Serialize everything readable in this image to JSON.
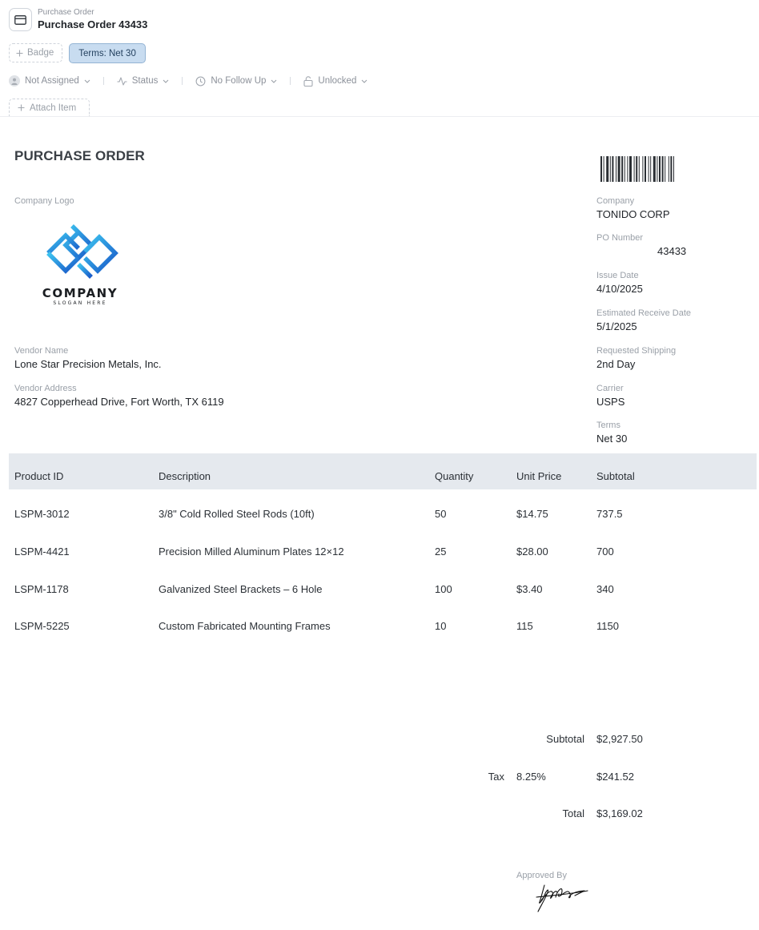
{
  "header": {
    "breadcrumb": "Purchase Order",
    "title": "Purchase Order 43433",
    "doc_icon": "card-icon"
  },
  "badges": {
    "add_label": "Badge",
    "terms_chip": "Terms: Net 30"
  },
  "status_bar": {
    "assignee": "Not Assigned",
    "status": "Status",
    "follow_up": "No Follow Up",
    "lock": "Unlocked"
  },
  "attach": {
    "label": "Attach Item"
  },
  "document": {
    "title": "PURCHASE ORDER",
    "logo": {
      "label": "Company Logo",
      "wordmark": "COMPANY",
      "slogan": "SLOGAN HERE"
    },
    "vendor": {
      "name_label": "Vendor Name",
      "name": "Lone Star Precision Metals, Inc.",
      "address_label": "Vendor Address",
      "address": "4827 Copperhead Drive, Fort Worth, TX 6119"
    },
    "details": {
      "company_label": "Company",
      "company": "TONIDO CORP",
      "po_label": "PO Number",
      "po": "43433",
      "issue_label": "Issue Date",
      "issue": "4/10/2025",
      "receive_label": "Estimated Receive Date",
      "receive": "5/1/2025",
      "shipping_label": "Requested Shipping",
      "shipping": "2nd Day",
      "carrier_label": "Carrier",
      "carrier": "USPS",
      "terms_label": "Terms",
      "terms": "Net 30"
    },
    "table": {
      "headers": [
        "Product ID",
        "Description",
        "Quantity",
        "Unit Price",
        "Subtotal"
      ],
      "rows": [
        [
          "LSPM-3012",
          "3/8\" Cold Rolled Steel Rods (10ft)",
          "50",
          "$14.75",
          "737.5"
        ],
        [
          "LSPM-4421",
          "Precision Milled Aluminum Plates 12×12",
          "25",
          "$28.00",
          "700"
        ],
        [
          "LSPM-1178",
          "Galvanized Steel Brackets – 6 Hole",
          "100",
          "$3.40",
          "340"
        ],
        [
          "LSPM-5225",
          "Custom Fabricated Mounting Frames",
          "10",
          "115",
          "1150"
        ]
      ]
    },
    "totals": {
      "subtotal_label": "Subtotal",
      "subtotal": "$2,927.50",
      "tax_label": "Tax",
      "tax_rate": "8.25%",
      "tax": "$241.52",
      "total_label": "Total",
      "total": "$3,169.02"
    },
    "approval": {
      "label": "Approved By"
    }
  }
}
